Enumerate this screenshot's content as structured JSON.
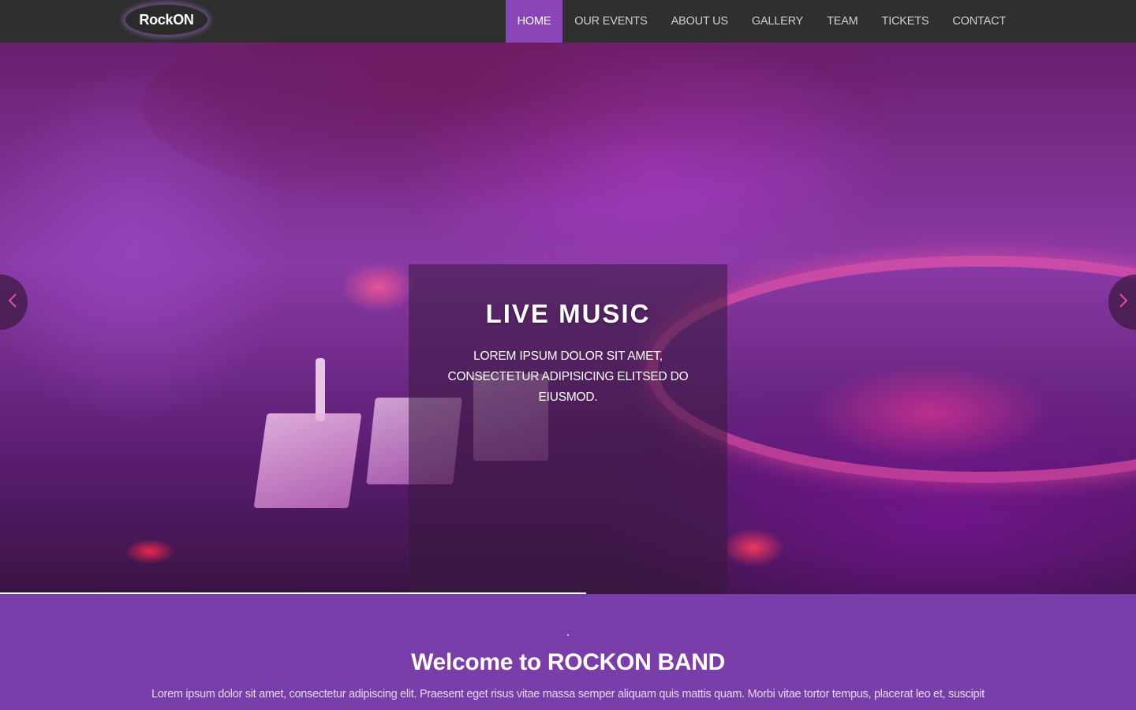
{
  "navbar": {
    "logo_text": "RockON",
    "items": [
      {
        "label": "HOME",
        "active": true
      },
      {
        "label": "OUR EVENTS",
        "active": false
      },
      {
        "label": "ABOUT US",
        "active": false
      },
      {
        "label": "GALLERY",
        "active": false
      },
      {
        "label": "TEAM",
        "active": false
      },
      {
        "label": "TICKETS",
        "active": false
      },
      {
        "label": "CONTACT",
        "active": false
      }
    ]
  },
  "hero": {
    "title": "LIVE MUSIC",
    "text": "LOREM IPSUM DOLOR SIT AMET, CONSECTETUR ADIPISICING ELITSED DO EIUSMOD.",
    "prev_icon": "chevron-left-icon",
    "next_icon": "chevron-right-icon",
    "progress_fraction": 0.516
  },
  "welcome": {
    "title": "Welcome to ROCKON BAND",
    "text": "Lorem ipsum dolor sit amet, consectetur adipiscing elit. Praesent eget risus vitae massa semper aliquam quis mattis quam. Morbi vitae tortor tempus, placerat leo et, suscipit"
  },
  "colors": {
    "navbar_bg": "#2f2f2f",
    "nav_active_bg": "#8a45b8",
    "section_bg": "#7a3eab",
    "arrow_color": "#e0558f"
  }
}
